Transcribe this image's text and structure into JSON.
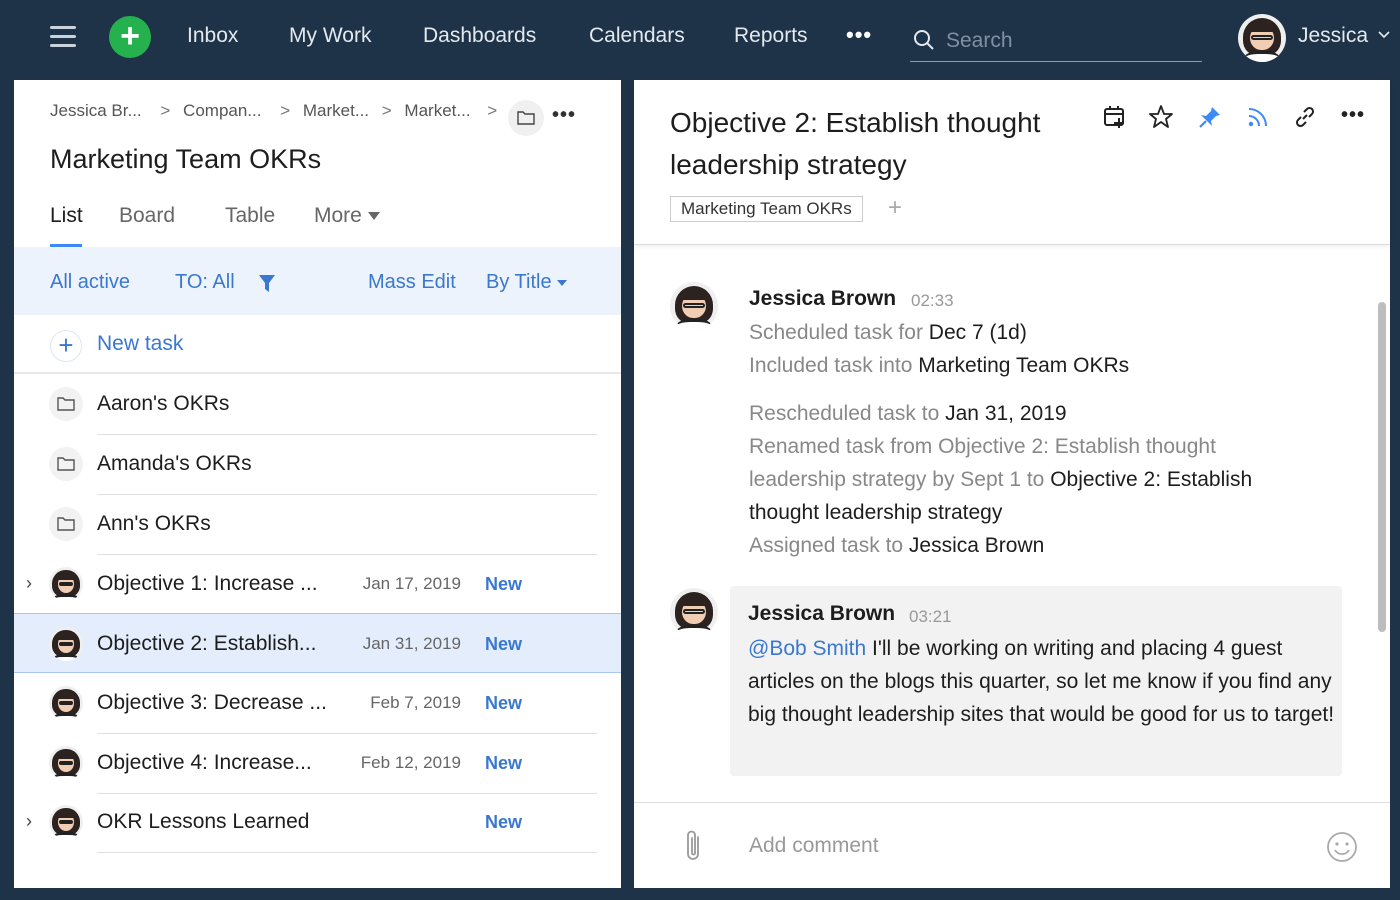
{
  "nav": {
    "items": [
      "Inbox",
      "My Work",
      "Dashboards",
      "Calendars",
      "Reports"
    ],
    "more": "•••",
    "search_placeholder": "Search",
    "user_name": "Jessica"
  },
  "left": {
    "breadcrumb": [
      "Jessica Br...",
      "Compan...",
      "Market...",
      "Market..."
    ],
    "crumb_sep": ">",
    "more_dots": "•••",
    "title": "Marketing Team OKRs",
    "tabs": [
      "List",
      "Board",
      "Table",
      "More"
    ],
    "filters": {
      "status": "All active",
      "assignee": "TO: All",
      "mass_edit": "Mass Edit",
      "sort": "By Title"
    },
    "new_task": "New task",
    "folders": [
      "Aaron's OKRs",
      "Amanda's OKRs",
      "Ann's OKRs"
    ],
    "tasks": [
      {
        "title": "Objective 1: Increase ...",
        "date": "Jan 17, 2019",
        "status": "New"
      },
      {
        "title": "Objective 2: Establish...",
        "date": "Jan 31, 2019",
        "status": "New"
      },
      {
        "title": "Objective 3: Decrease ...",
        "date": "Feb 7, 2019",
        "status": "New"
      },
      {
        "title": "Objective 4: Increase...",
        "date": "Feb 12, 2019",
        "status": "New"
      },
      {
        "title": "OKR Lessons Learned",
        "date": "",
        "status": "New"
      }
    ],
    "expander": "›"
  },
  "right": {
    "title": "Objective 2: Establish thought leadership strategy",
    "folder_tag": "Marketing Team OKRs",
    "tag_add": "+",
    "more_dots": "•••",
    "activity": {
      "author": "Jessica Brown",
      "time": "02:33",
      "lines": [
        {
          "prefix": "Scheduled task for ",
          "value": "Dec 7 (1d)"
        },
        {
          "prefix": "Included task into ",
          "value": "Marketing Team OKRs"
        },
        {
          "prefix": "Rescheduled task to ",
          "value": "Jan 31, 2019"
        },
        {
          "prefix": "Renamed task from Objective 2: Establish thought",
          "value": ""
        },
        {
          "prefix": "leadership strategy by Sept 1 to ",
          "value": "Objective 2: Establish"
        },
        {
          "prefix": "",
          "value": "thought leadership strategy"
        },
        {
          "prefix": "Assigned task to ",
          "value": "Jessica Brown"
        }
      ]
    },
    "comment": {
      "author": "Jessica Brown",
      "time": "03:21",
      "mention": "@Bob Smith",
      "text": " I'll be working on writing and placing 4 guest articles on the blogs this quarter, so let me know if you find any big thought leadership sites that would be good for us to target!"
    },
    "add_comment_placeholder": "Add comment"
  },
  "colors": {
    "topbar": "#1f3348",
    "accent": "#3a78cf",
    "add_button": "#26b14f",
    "pin": "#3d8af7"
  }
}
